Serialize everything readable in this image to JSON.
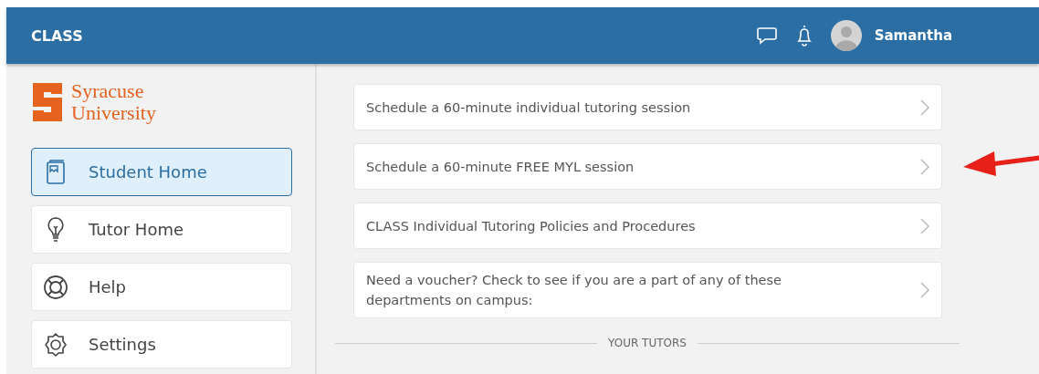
{
  "header": {
    "title": "CLASS",
    "user_name": "Samantha"
  },
  "sidebar": {
    "logo": {
      "line_1": "Syracuse",
      "line_2": "University"
    },
    "items": [
      {
        "label": "Student Home",
        "kind": "book",
        "selected": true
      },
      {
        "label": "Tutor Home",
        "kind": "bulb",
        "selected": false
      },
      {
        "label": "Help",
        "kind": "lifebuoy",
        "selected": false
      },
      {
        "label": "Settings",
        "kind": "gear",
        "selected": false
      }
    ]
  },
  "links": [
    {
      "text": "Schedule a 60-minute individual tutoring session",
      "highlighted": false
    },
    {
      "text": "Schedule a 60-minute FREE MYL session",
      "highlighted": true
    },
    {
      "text": "CLASS Individual Tutoring Policies and Procedures",
      "highlighted": false
    },
    {
      "text": "Need a voucher? Check to see if you are a part of any of these departments on campus:",
      "highlighted": false
    }
  ],
  "section_heading": "YOUR TUTORS"
}
